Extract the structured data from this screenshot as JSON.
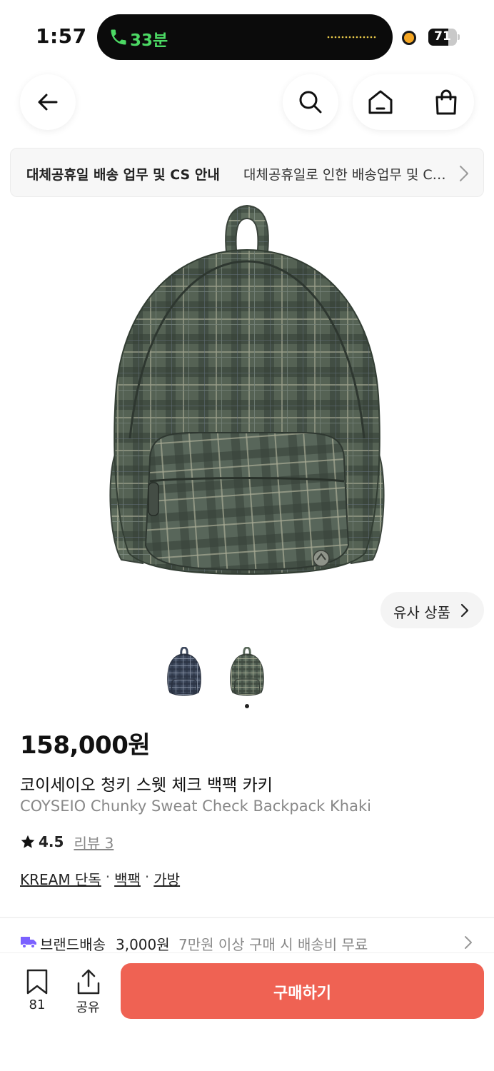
{
  "status_bar": {
    "time": "1:57",
    "call_duration": "33분",
    "battery": "71",
    "battery_level": 0.71
  },
  "nav": {
    "back_icon": "arrow-left-icon",
    "search_icon": "search-icon",
    "home_icon": "home-icon",
    "cart_icon": "shopping-bag-icon"
  },
  "notice": {
    "title": "대체공휴일 배송 업무 및 CS 안내",
    "text": "대체공휴일로 인한 배송업무 및 CS 업무 안내"
  },
  "product": {
    "similar_label": "유사 상품",
    "price": "158,000원",
    "name_ko": "코이세이오 청키 스웻 체크 백팩 카키",
    "name_en": "COYSEIO Chunky Sweat Check Backpack Khaki",
    "rating": "4.5",
    "review_label": "리뷰 3",
    "tags": [
      "KREAM 단독",
      "백팩",
      "가방"
    ],
    "tag_separator": "·",
    "colors": {
      "khaki": "#5b6a5c",
      "navy": "#3f4a5e"
    }
  },
  "delivery": {
    "label": "브랜드배송",
    "price": "3,000원",
    "note": "7만원 이상 구매 시 배송비 무료",
    "icon_color": "#7b61ff"
  },
  "bottom_bar": {
    "bookmark_count": "81",
    "share_label": "공유",
    "buy_label": "구매하기",
    "buy_color": "#ef6253"
  }
}
